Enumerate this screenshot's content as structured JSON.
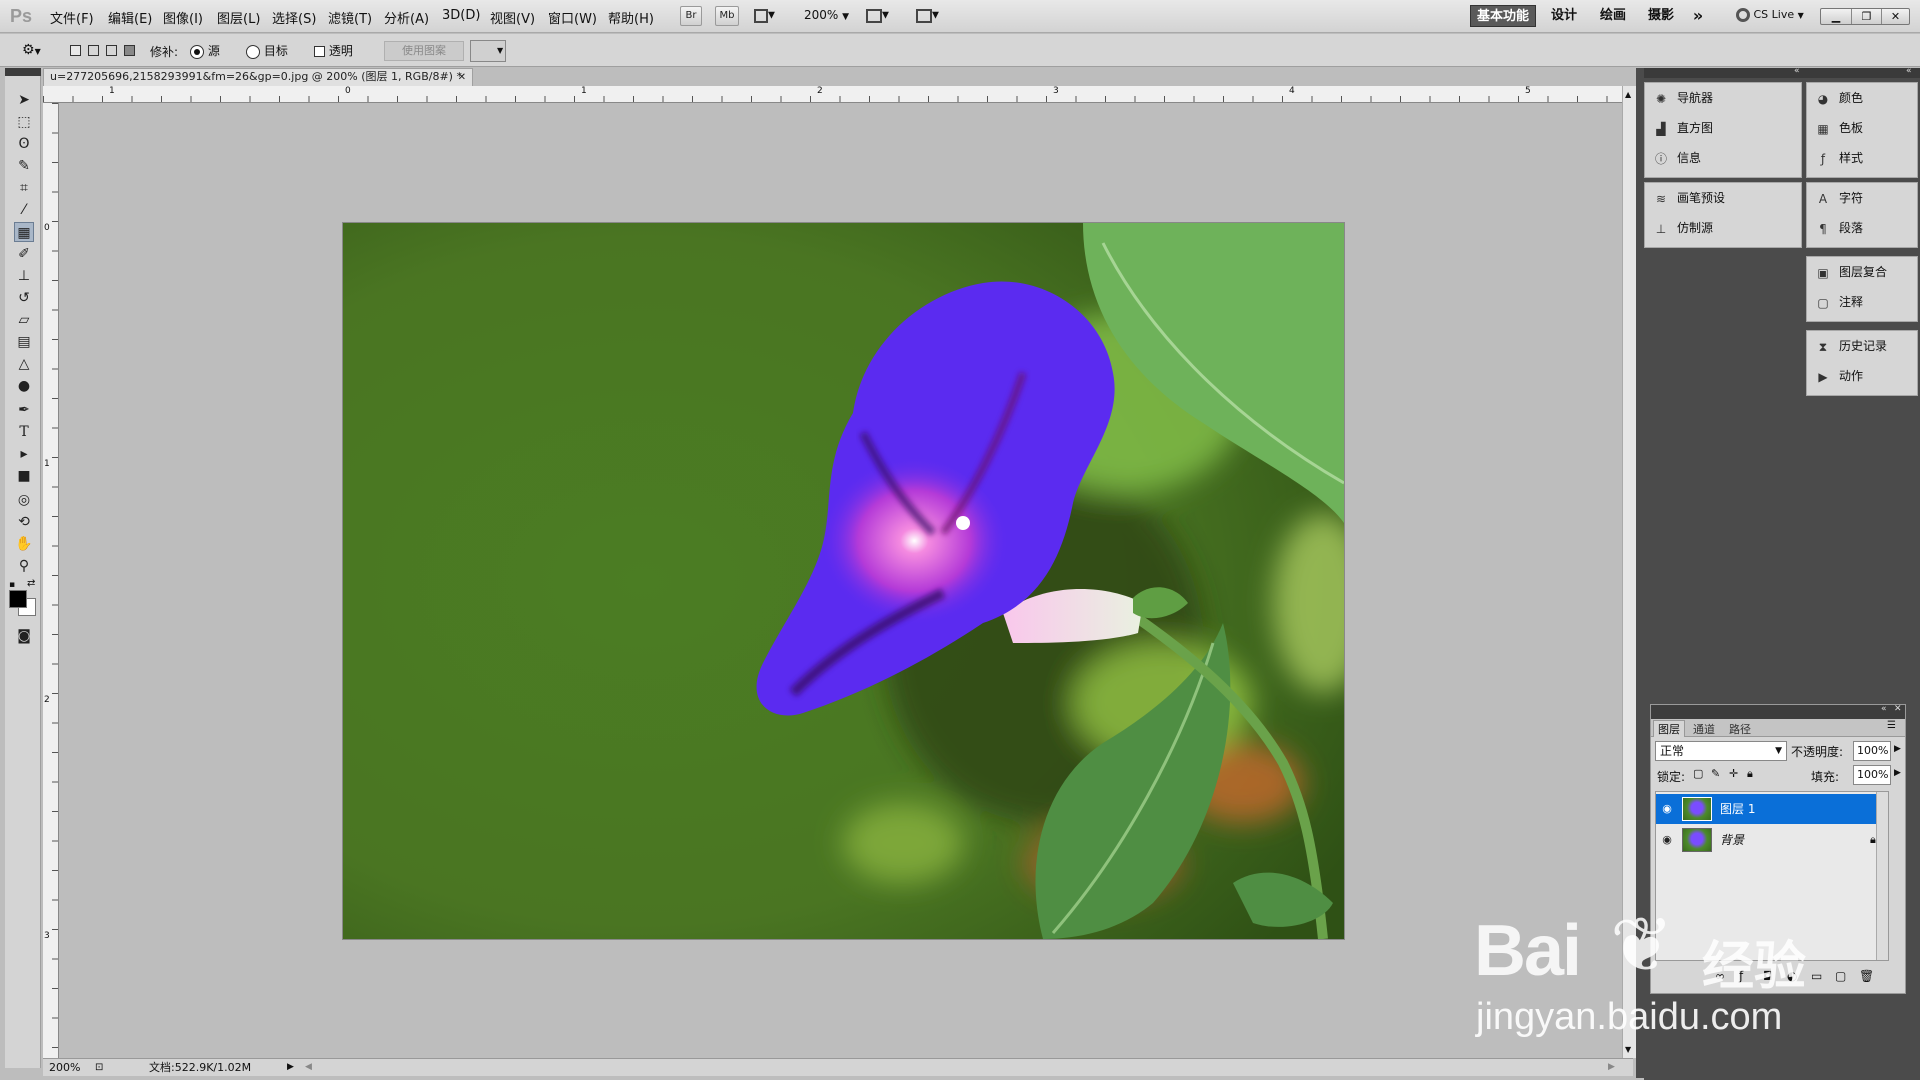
{
  "menubar": {
    "logo": "Ps",
    "items": [
      "文件(F)",
      "编辑(E)",
      "图像(I)",
      "图层(L)",
      "选择(S)",
      "滤镜(T)",
      "分析(A)",
      "3D(D)",
      "视图(V)",
      "窗口(W)",
      "帮助(H)"
    ],
    "bridge_label": "Br",
    "minibridge_label": "Mb",
    "zoom": "200%",
    "workspaces": [
      "基本功能",
      "设计",
      "绘画",
      "摄影"
    ],
    "more": "»",
    "cslive": "CS Live"
  },
  "options": {
    "patch_label": "修补:",
    "source_label": "源",
    "target_label": "目标",
    "transparent_label": "透明",
    "use_pattern_label": "使用图案"
  },
  "document": {
    "tab_title": "u=277205696,2158293991&fm=26&gp=0.jpg @ 200% (图层 1, RGB/8#) *",
    "ruler_top_labels": [
      "1",
      "0",
      "1",
      "2",
      "3",
      "4",
      "5"
    ],
    "ruler_left_labels": [
      "0",
      "1",
      "2",
      "3"
    ]
  },
  "status": {
    "zoom": "200%",
    "doc_size": "文档:522.9K/1.02M"
  },
  "panels": {
    "left_group1": [
      "导航器",
      "直方图",
      "信息"
    ],
    "left_group2": [
      "画笔预设",
      "仿制源"
    ],
    "right_group1": [
      "颜色",
      "色板",
      "样式"
    ],
    "right_group2": [
      "字符",
      "段落"
    ],
    "right_group3": [
      "图层复合",
      "注释"
    ],
    "right_group4": [
      "历史记录",
      "动作"
    ]
  },
  "layers": {
    "tabs": [
      "图层",
      "通道",
      "路径"
    ],
    "blend_mode": "正常",
    "opacity_label": "不透明度:",
    "opacity_value": "100%",
    "lock_label": "锁定:",
    "fill_label": "填充:",
    "fill_value": "100%",
    "rows": [
      {
        "name": "图层 1",
        "selected": true
      },
      {
        "name": "背景",
        "locked": true
      }
    ]
  },
  "watermark": {
    "brand": "Bai",
    "brand_suffix": "经验",
    "url": "jingyan.baidu.com"
  },
  "colors": {
    "selection_blue": "#0a6fd8",
    "dock_dark": "#4b4b4b",
    "flower_purple": "#5b2bf0"
  }
}
